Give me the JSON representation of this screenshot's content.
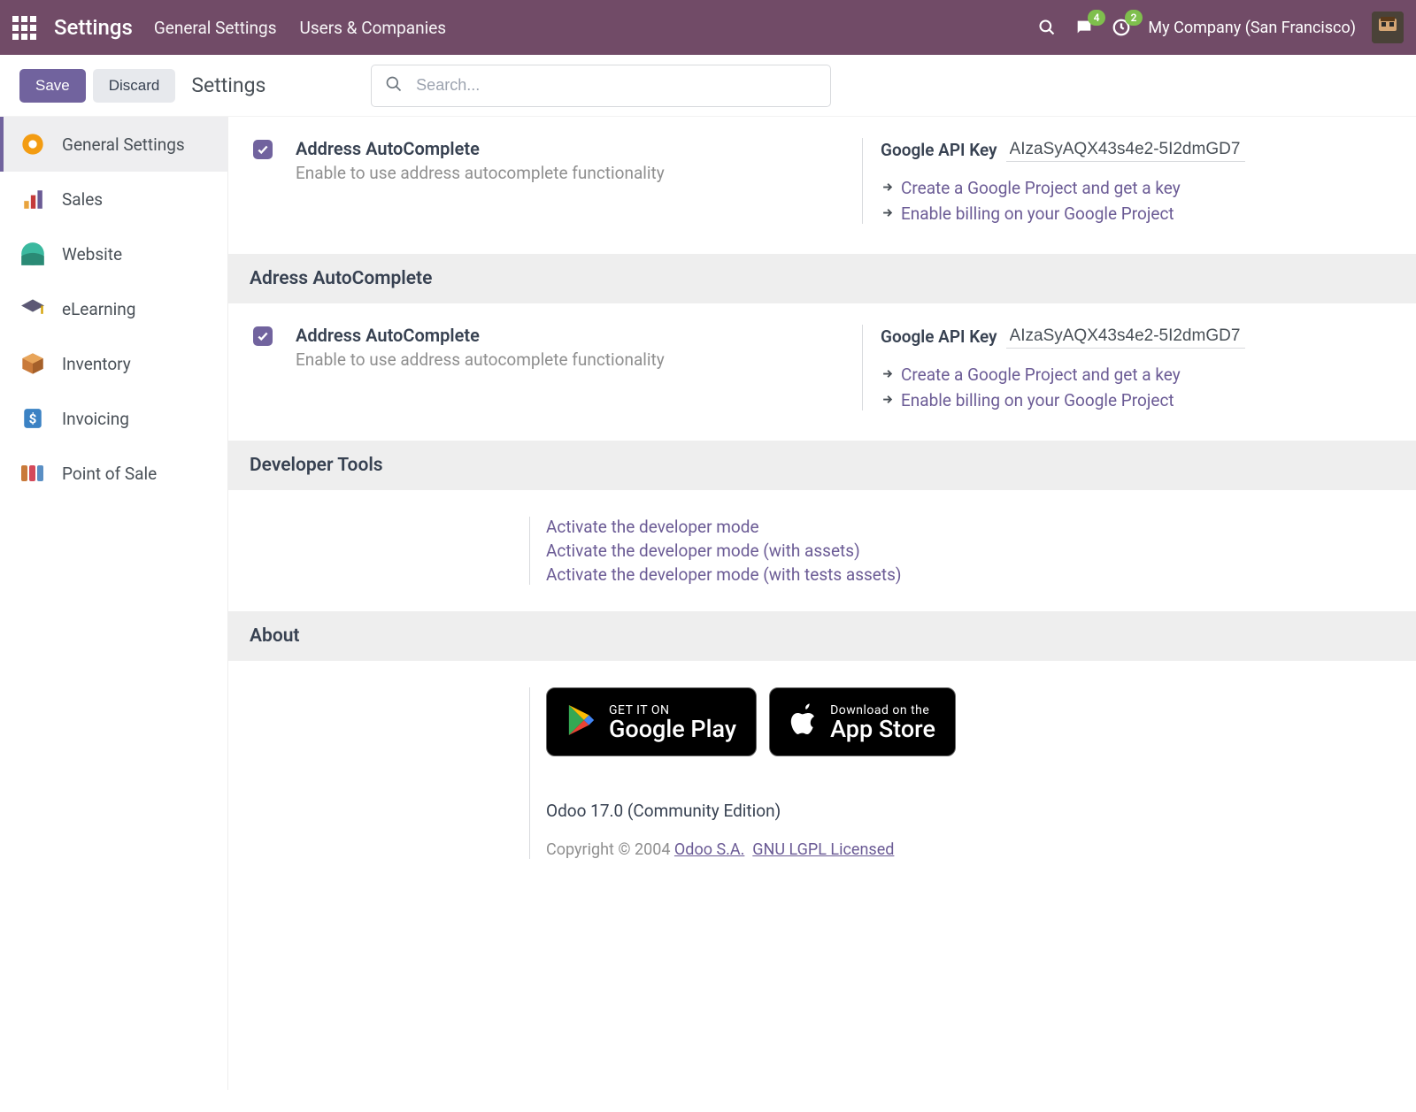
{
  "navbar": {
    "title": "Settings",
    "menu": [
      "General Settings",
      "Users & Companies"
    ],
    "messages_badge": "4",
    "activities_badge": "2",
    "company": "My Company (San Francisco)"
  },
  "actions": {
    "save": "Save",
    "discard": "Discard",
    "page_title": "Settings",
    "search_placeholder": "Search..."
  },
  "sidebar": [
    {
      "key": "general",
      "label": "General Settings"
    },
    {
      "key": "sales",
      "label": "Sales"
    },
    {
      "key": "website",
      "label": "Website"
    },
    {
      "key": "elearning",
      "label": "eLearning"
    },
    {
      "key": "inventory",
      "label": "Inventory"
    },
    {
      "key": "invoicing",
      "label": "Invoicing"
    },
    {
      "key": "pos",
      "label": "Point of Sale"
    }
  ],
  "settings": {
    "addr1": {
      "title": "Address AutoComplete",
      "desc": "Enable to use address autocomplete functionality",
      "api_label": "Google API Key",
      "api_value": "AIzaSyAQX43s4e2-5I2dmGD7",
      "link_create": "Create a Google Project and get a key",
      "link_billing": "Enable billing on your Google Project"
    },
    "sec_addr_header": "Adress AutoComplete",
    "addr2": {
      "title": "Address AutoComplete",
      "desc": "Enable to use address autocomplete functionality",
      "api_label": "Google API Key",
      "api_value": "AIzaSyAQX43s4e2-5I2dmGD7",
      "link_create": "Create a Google Project and get a key",
      "link_billing": "Enable billing on your Google Project"
    },
    "sec_dev_header": "Developer Tools",
    "dev": {
      "l1": "Activate the developer mode",
      "l2": "Activate the developer mode (with assets)",
      "l3": "Activate the developer mode (with tests assets)"
    },
    "sec_about_header": "About",
    "about": {
      "gplay_small": "GET IT ON",
      "gplay_big": "Google Play",
      "appstore_small": "Download on the",
      "appstore_big": "App Store",
      "version": "Odoo 17.0 (Community Edition)",
      "copyright_prefix": "Copyright © 2004 ",
      "odoo_link": "Odoo S.A.",
      "license_link": "GNU LGPL Licensed"
    }
  }
}
